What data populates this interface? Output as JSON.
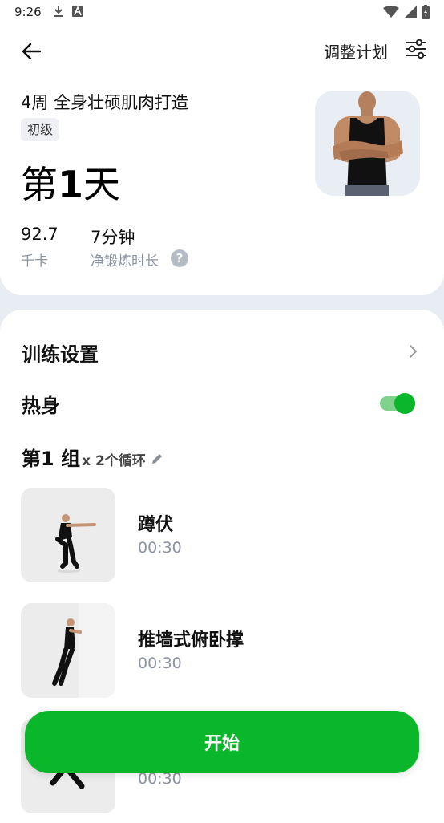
{
  "status_bar": {
    "time": "9:26",
    "left_icons": [
      "download-icon",
      "font-icon"
    ],
    "right_icons": [
      "wifi-icon",
      "signal-icon",
      "battery-icon"
    ]
  },
  "header": {
    "back_icon": "arrow-left-icon",
    "adjust_plan_label": "调整计划",
    "settings_icon": "sliders-icon"
  },
  "plan": {
    "title": "4周 全身壮硕肌肉打造",
    "level": "初级",
    "day_prefix": "第",
    "day_number": "1",
    "day_suffix": "天",
    "calories_value": "92.7",
    "calories_label": "千卡",
    "duration_value": "7分钟",
    "duration_label": "净锻炼时长",
    "help_symbol": "?"
  },
  "settings": {
    "training_settings_label": "训练设置",
    "warmup_label": "热身",
    "warmup_enabled": true
  },
  "group": {
    "name": "第1 组",
    "loops": "x 2个循环"
  },
  "exercises": [
    {
      "name": "蹲伏",
      "time": "00:30"
    },
    {
      "name": "推墙式俯卧撑",
      "time": "00:30"
    },
    {
      "name": "",
      "time": "00:30"
    }
  ],
  "start_button_label": "开始",
  "colors": {
    "accent": "#0ab72b",
    "toggle_track": "#7fd28c",
    "muted_text": "#8a93a0",
    "page_background": "#e8ecf3"
  }
}
